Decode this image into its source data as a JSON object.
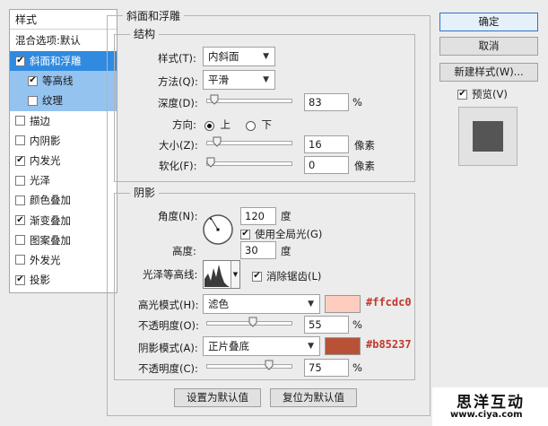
{
  "style_list": {
    "header": "样式",
    "blend_options": "混合选项:默认",
    "items": [
      {
        "label": "斜面和浮雕",
        "checked": true,
        "selected": true
      },
      {
        "label": "等高线",
        "checked": true,
        "sub": true
      },
      {
        "label": "纹理",
        "checked": false,
        "sub": true
      },
      {
        "label": "描边",
        "checked": false
      },
      {
        "label": "内阴影",
        "checked": false
      },
      {
        "label": "内发光",
        "checked": true
      },
      {
        "label": "光泽",
        "checked": false
      },
      {
        "label": "颜色叠加",
        "checked": false
      },
      {
        "label": "渐变叠加",
        "checked": true
      },
      {
        "label": "图案叠加",
        "checked": false
      },
      {
        "label": "外发光",
        "checked": false
      },
      {
        "label": "投影",
        "checked": true
      }
    ]
  },
  "bevel": {
    "title": "斜面和浮雕",
    "structure_title": "结构",
    "style_label": "样式(T):",
    "style_value": "内斜面",
    "technique_label": "方法(Q):",
    "technique_value": "平滑",
    "depth_label": "深度(D):",
    "depth_value": "83",
    "depth_unit": "%",
    "depth_pos": 0.05,
    "direction_label": "方向:",
    "dir_up": "上",
    "dir_down": "下",
    "size_label": "大小(Z):",
    "size_value": "16",
    "size_unit": "像素",
    "size_pos": 0.08,
    "soften_label": "软化(F):",
    "soften_value": "0",
    "soften_unit": "像素",
    "soften_pos": 0.0
  },
  "shading": {
    "title": "阴影",
    "angle_label": "角度(N):",
    "angle_value": "120",
    "angle_unit": "度",
    "global_light_label": "使用全局光(G)",
    "altitude_label": "高度:",
    "altitude_value": "30",
    "altitude_unit": "度",
    "gloss_contour_label": "光泽等高线:",
    "antialias_label": "消除锯齿(L)",
    "highlight_mode_label": "高光模式(H):",
    "highlight_mode_value": "滤色",
    "highlight_color": "#ffcdc0",
    "highlight_color_label": "#ffcdc0",
    "highlight_opacity_label": "不透明度(O):",
    "highlight_opacity_value": "55",
    "highlight_opacity_unit": "%",
    "highlight_opacity_pos": 0.55,
    "shadow_mode_label": "阴影模式(A):",
    "shadow_mode_value": "正片叠底",
    "shadow_color": "#b85237",
    "shadow_color_label": "#b85237",
    "shadow_opacity_label": "不透明度(C):",
    "shadow_opacity_value": "75",
    "shadow_opacity_unit": "%",
    "shadow_opacity_pos": 0.75
  },
  "footer": {
    "make_default": "设置为默认值",
    "reset_default": "复位为默认值"
  },
  "side_buttons": {
    "ok": "确定",
    "cancel": "取消",
    "new_style": "新建样式(W)...",
    "preview": "预览(V)"
  },
  "watermark": {
    "title": "思洋互动",
    "url": "www.ciya.com"
  }
}
